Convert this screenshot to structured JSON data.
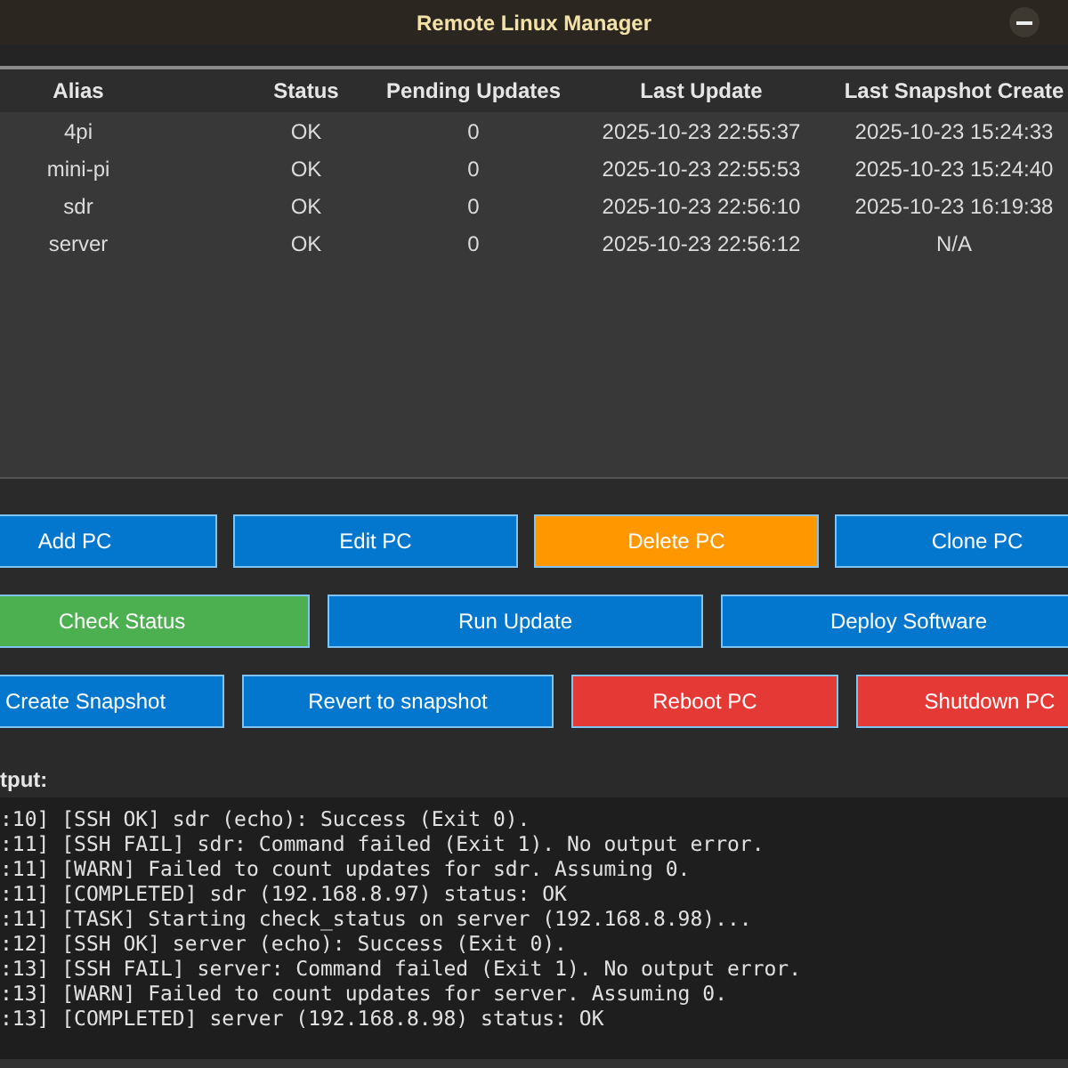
{
  "window": {
    "title": "Remote Linux Manager"
  },
  "table": {
    "columns": [
      "Alias",
      "Status",
      "Pending Updates",
      "Last Update",
      "Last Snapshot Create"
    ],
    "rows": [
      [
        "4pi",
        "OK",
        "0",
        "2025-10-23 22:55:37",
        "2025-10-23 15:24:33"
      ],
      [
        "mini-pi",
        "OK",
        "0",
        "2025-10-23 22:55:53",
        "2025-10-23 15:24:40"
      ],
      [
        "sdr",
        "OK",
        "0",
        "2025-10-23 22:56:10",
        "2025-10-23 16:19:38"
      ],
      [
        "server",
        "OK",
        "0",
        "2025-10-23 22:56:12",
        "N/A"
      ]
    ]
  },
  "button_rows": [
    [
      {
        "label": "Add PC",
        "color": "#0277cd"
      },
      {
        "label": "Edit PC",
        "color": "#0277cd"
      },
      {
        "label": "Delete PC",
        "color": "#ff9800"
      },
      {
        "label": "Clone PC",
        "color": "#0277cd"
      }
    ],
    [
      {
        "label": "Check Status",
        "color": "#4caf50"
      },
      {
        "label": "Run Update",
        "color": "#0277cd"
      },
      {
        "label": "Deploy Software",
        "color": "#0277cd"
      }
    ],
    [
      {
        "label": "Create Snapshot",
        "color": "#0277cd"
      },
      {
        "label": "Revert to snapshot",
        "color": "#0277cd"
      },
      {
        "label": "Reboot PC",
        "color": "#e53935"
      },
      {
        "label": "Shutdown PC",
        "color": "#e53935"
      }
    ]
  ],
  "output": {
    "label": "tput:",
    "lines": [
      ":10] [SSH OK] sdr (echo): Success (Exit 0).",
      ":11] [SSH FAIL] sdr: Command failed (Exit 1). No output error.",
      ":11] [WARN] Failed to count updates for sdr. Assuming 0.",
      ":11] [COMPLETED] sdr (192.168.8.97) status: OK",
      ":11] [TASK] Starting check_status on server (192.168.8.98)...",
      ":12] [SSH OK] server (echo): Success (Exit 0).",
      ":13] [SSH FAIL] server: Command failed (Exit 1). No output error.",
      ":13] [WARN] Failed to count updates for server. Assuming 0.",
      ":13] [COMPLETED] server (192.168.8.98) status: OK"
    ]
  }
}
